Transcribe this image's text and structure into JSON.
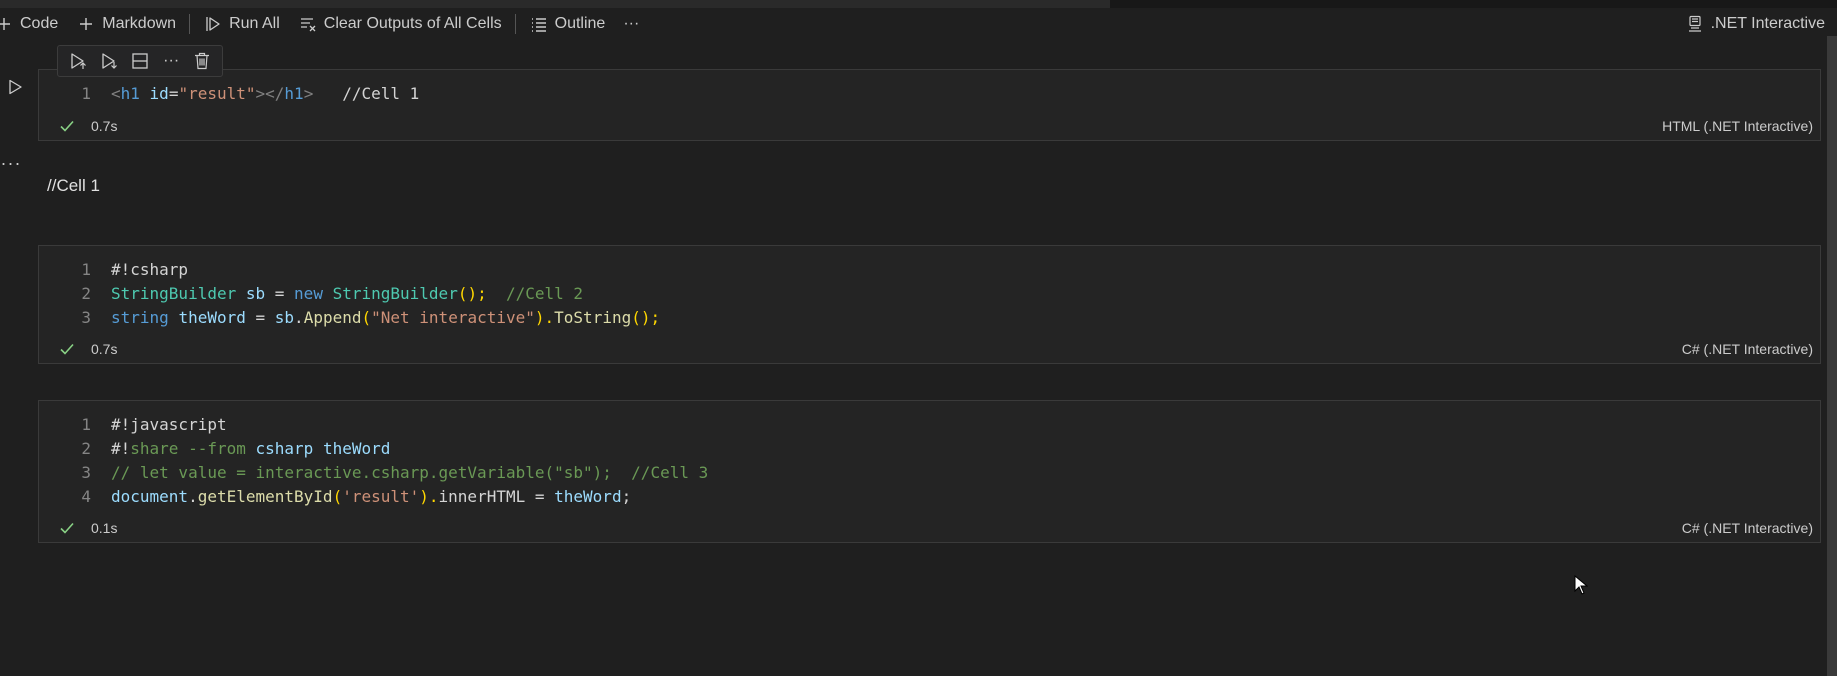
{
  "toolbar": {
    "code_label": "Code",
    "markdown_label": "Markdown",
    "run_all_label": "Run All",
    "clear_outputs_label": "Clear Outputs of All Cells",
    "outline_label": "Outline",
    "more_label": "···",
    "kernel_label": ".NET Interactive"
  },
  "cell_toolbar": {
    "more_label": "···"
  },
  "gutter": {
    "more_label": "···"
  },
  "cells": [
    {
      "lines": [
        {
          "n": "1",
          "tokens": [
            {
              "t": "<",
              "c": "dim"
            },
            {
              "t": "h1",
              "c": "tag"
            },
            {
              "t": " ",
              "c": "plain"
            },
            {
              "t": "id",
              "c": "attr"
            },
            {
              "t": "=",
              "c": "plain"
            },
            {
              "t": "\"result\"",
              "c": "str"
            },
            {
              "t": ">",
              "c": "dim"
            },
            {
              "t": "</",
              "c": "dim"
            },
            {
              "t": "h1",
              "c": "tag"
            },
            {
              "t": ">",
              "c": "dim"
            },
            {
              "t": "   //Cell 1",
              "c": "plain"
            }
          ]
        }
      ],
      "duration": "0.7s",
      "language": "HTML (.NET Interactive)",
      "output": "//Cell 1"
    },
    {
      "lines": [
        {
          "n": "1",
          "tokens": [
            {
              "t": "#!csharp",
              "c": "plain"
            }
          ]
        },
        {
          "n": "2",
          "tokens": [
            {
              "t": "StringBuilder",
              "c": "type"
            },
            {
              "t": " ",
              "c": "plain"
            },
            {
              "t": "sb",
              "c": "var"
            },
            {
              "t": " = ",
              "c": "plain"
            },
            {
              "t": "new",
              "c": "kw"
            },
            {
              "t": " ",
              "c": "plain"
            },
            {
              "t": "StringBuilder",
              "c": "type"
            },
            {
              "t": "();",
              "c": "brk"
            },
            {
              "t": "  ",
              "c": "plain"
            },
            {
              "t": "//Cell 2",
              "c": "cmt"
            }
          ]
        },
        {
          "n": "3",
          "tokens": [
            {
              "t": "string",
              "c": "kw"
            },
            {
              "t": " ",
              "c": "plain"
            },
            {
              "t": "theWord",
              "c": "var"
            },
            {
              "t": " = ",
              "c": "plain"
            },
            {
              "t": "sb",
              "c": "var"
            },
            {
              "t": ".",
              "c": "plain"
            },
            {
              "t": "Append",
              "c": "fn"
            },
            {
              "t": "(",
              "c": "brk"
            },
            {
              "t": "\"Net interactive\"",
              "c": "str"
            },
            {
              "t": ").",
              "c": "brk"
            },
            {
              "t": "ToString",
              "c": "fn"
            },
            {
              "t": "();",
              "c": "brk"
            }
          ]
        }
      ],
      "duration": "0.7s",
      "language": "C# (.NET Interactive)"
    },
    {
      "lines": [
        {
          "n": "1",
          "tokens": [
            {
              "t": "#!javascript",
              "c": "plain"
            }
          ]
        },
        {
          "n": "2",
          "tokens": [
            {
              "t": "#!",
              "c": "plain"
            },
            {
              "t": "share",
              "c": "cmt"
            },
            {
              "t": " --from ",
              "c": "cmt"
            },
            {
              "t": "csharp",
              "c": "var"
            },
            {
              "t": " ",
              "c": "plain"
            },
            {
              "t": "theWord",
              "c": "var"
            }
          ]
        },
        {
          "n": "3",
          "tokens": [
            {
              "t": "// let value = interactive.csharp.getVariable(\"sb\");  //Cell 3",
              "c": "cmt"
            }
          ]
        },
        {
          "n": "4",
          "tokens": [
            {
              "t": "document",
              "c": "var"
            },
            {
              "t": ".",
              "c": "plain"
            },
            {
              "t": "getElementById",
              "c": "fn"
            },
            {
              "t": "(",
              "c": "brk"
            },
            {
              "t": "'result'",
              "c": "str"
            },
            {
              "t": ").",
              "c": "brk"
            },
            {
              "t": "innerHTML",
              "c": "plain"
            },
            {
              "t": " = ",
              "c": "plain"
            },
            {
              "t": "theWord",
              "c": "var"
            },
            {
              "t": ";",
              "c": "plain"
            }
          ]
        }
      ],
      "duration": "0.1s",
      "language": "C# (.NET Interactive)"
    }
  ],
  "icons": {
    "add": "plus-icon",
    "run_all": "run-all-icon",
    "clear": "clear-all-icon",
    "outline": "list-icon",
    "kernel": "kernel-icon",
    "check": "check-icon"
  },
  "colors": {
    "background": "#1f1f1f",
    "cell_background": "#242424",
    "success": "#89d185",
    "keyword": "#569cd6",
    "type": "#4ec9b0",
    "string": "#ce9178",
    "comment": "#6a9955",
    "function": "#dcdcaa",
    "variable": "#9cdcfe"
  }
}
